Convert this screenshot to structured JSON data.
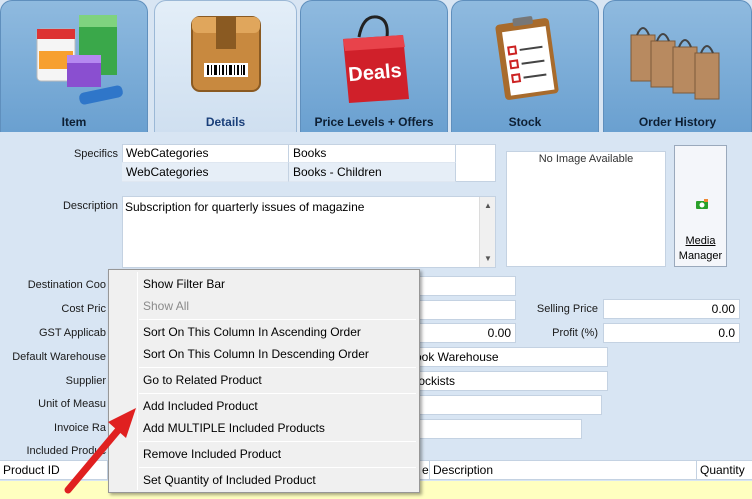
{
  "tabs": [
    {
      "label": "Item",
      "icon": "product-boxes-icon"
    },
    {
      "label": "Details",
      "icon": "cardboard-box-icon"
    },
    {
      "label": "Price Levels + Offers",
      "icon": "deals-bag-icon"
    },
    {
      "label": "Stock",
      "icon": "inventory-clipboard-icon"
    },
    {
      "label": "Order History",
      "icon": "shopping-bags-icon"
    }
  ],
  "form": {
    "specifics_label": "Specifics",
    "specifics": [
      {
        "category": "WebCategories",
        "value": "Books"
      },
      {
        "category": "WebCategories",
        "value": "Books - Children"
      }
    ],
    "description_label": "Description",
    "description": "Subscription for quarterly issues of magazine",
    "no_image": "No Image Available",
    "media_manager_line1": "Media",
    "media_manager_line2": "Manager",
    "labels": {
      "destination": "Destination Coo",
      "cost_price": "Cost Pric",
      "gst": "GST Applicab",
      "default_warehouse": "Default Warehouse",
      "supplier": "Supplier",
      "unit_of_measure": "Unit of Measu",
      "invoice_rate": "Invoice Ra",
      "included_products": "Included Produc"
    },
    "gst_value": "0.00",
    "warehouse_value": "ook Warehouse",
    "supplier_value": "tockists",
    "selling_price_label": "Selling Price",
    "selling_price": "0.00",
    "profit_label": "Profit (%)",
    "profit": "0.0"
  },
  "grid": {
    "columns": [
      "Product ID",
      "e",
      "Description",
      "Quantity"
    ]
  },
  "context_menu": {
    "items": [
      {
        "label": "Show Filter Bar",
        "enabled": true
      },
      {
        "label": "Show All",
        "enabled": false
      },
      {
        "label": "Sort On This Column In Ascending Order",
        "enabled": true
      },
      {
        "label": "Sort On This Column In Descending Order",
        "enabled": true
      },
      {
        "label": "Go to Related Product",
        "enabled": true
      },
      {
        "label": "Add Included Product",
        "enabled": true
      },
      {
        "label": "Add MULTIPLE Included Products",
        "enabled": true
      },
      {
        "label": "Remove Included Product",
        "enabled": true
      },
      {
        "label": "Set Quantity of Included Product",
        "enabled": true
      }
    ]
  },
  "colors": {
    "tab_blue": "#7aaedb",
    "active_tab": "#dbe8f5",
    "background": "#d8e5f3",
    "arrow_red": "#e02020",
    "grid_row_yellow": "#ffffc0"
  }
}
